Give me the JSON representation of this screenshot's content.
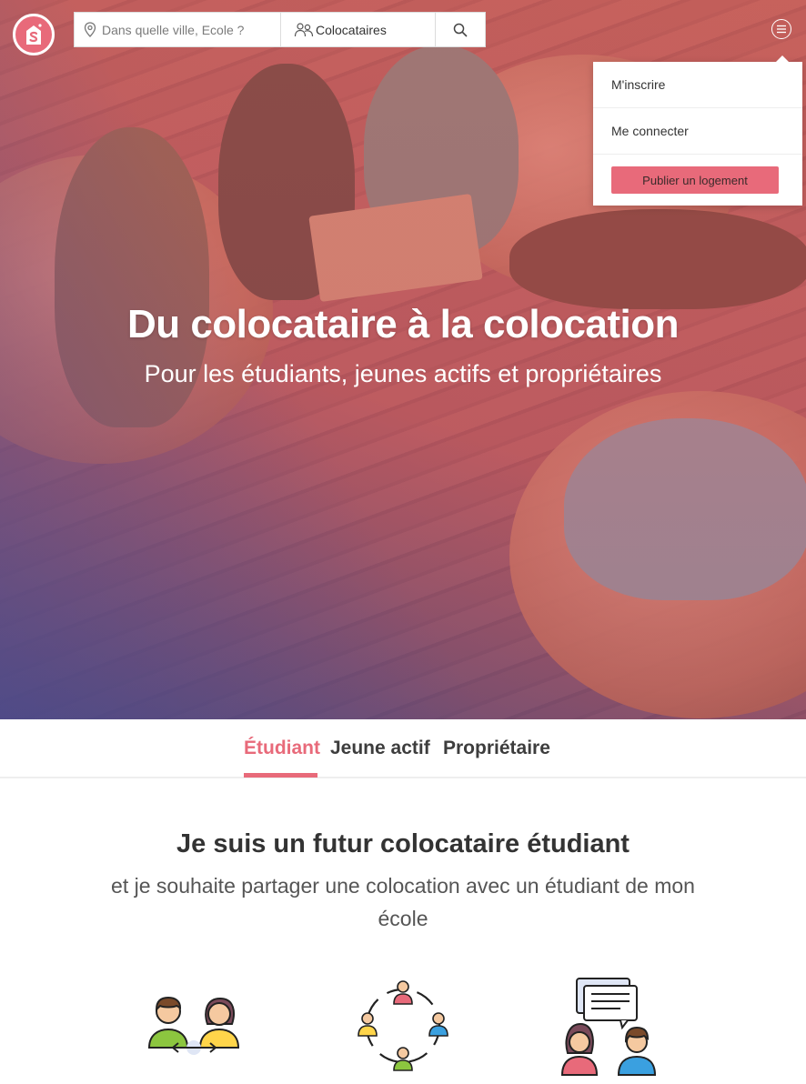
{
  "header": {
    "logo_icon": "house-s-logo-icon",
    "search": {
      "city_placeholder": "Dans quelle ville, Ecole ?",
      "city_value": "",
      "type_label": "Colocataires",
      "type_icon": "people-icon",
      "submit_icon": "search-icon"
    },
    "menu_icon": "hamburger-menu-icon"
  },
  "menu": {
    "items": [
      {
        "label": "M'inscrire"
      },
      {
        "label": "Me connecter"
      }
    ],
    "cta_label": "Publier un logement"
  },
  "hero": {
    "title": "Du colocataire à la colocation",
    "subtitle": "Pour les étudiants, jeunes actifs et propriétaires"
  },
  "tabs": [
    {
      "label": "Étudiant",
      "active": true
    },
    {
      "label": "Jeune actif",
      "active": false
    },
    {
      "label": "Propriétaire",
      "active": false
    }
  ],
  "section": {
    "title": "Je suis un futur colocataire étudiant",
    "subtitle": "et je souhaite partager une colocation avec un étudiant de mon école"
  },
  "features": [
    {
      "icon": "two-people-exchange-icon"
    },
    {
      "icon": "people-circle-network-icon"
    },
    {
      "icon": "people-chat-icon"
    }
  ],
  "colors": {
    "accent": "#e86a7a",
    "text_dark": "#333333",
    "text_muted": "#555555"
  }
}
